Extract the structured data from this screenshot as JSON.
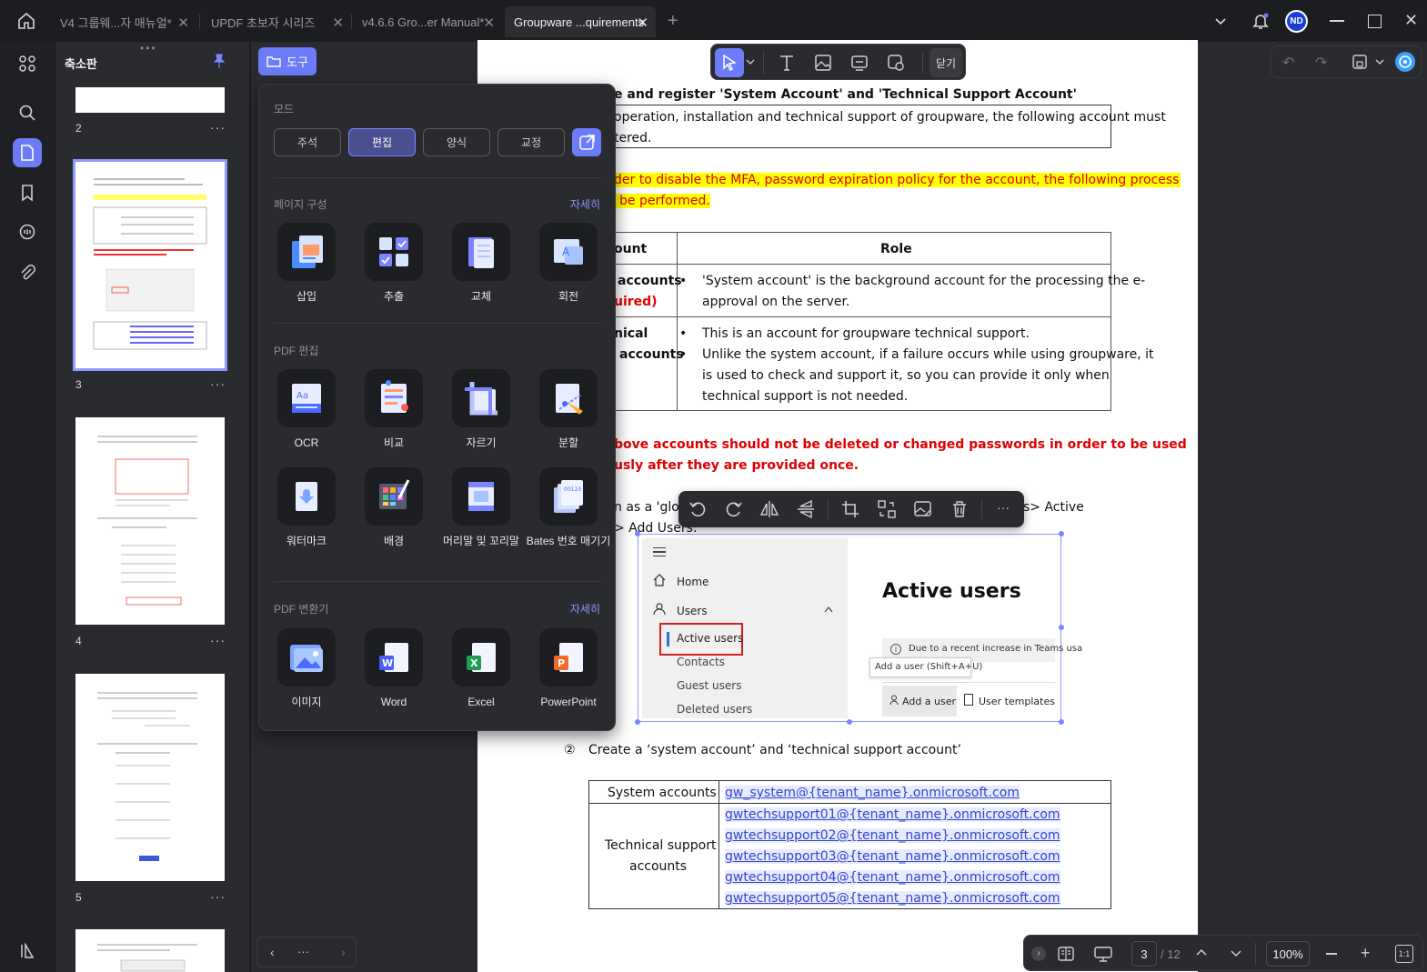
{
  "tabs": [
    {
      "label": "V4 그룹웨...자 매뉴얼*",
      "active": false
    },
    {
      "label": "UPDF 초보자 시리즈",
      "active": false
    },
    {
      "label": "v4.6.6 Gro...er Manual*",
      "active": false
    },
    {
      "label": "Groupware ...quirements",
      "active": true
    }
  ],
  "user_avatar": "ND",
  "thumbnails": {
    "title": "축소판",
    "pages": [
      "2",
      "3",
      "4",
      "5"
    ]
  },
  "tools_button": "도구",
  "tools_panel": {
    "mode_title": "모드",
    "modes": [
      "주석",
      "편집",
      "양식",
      "교정"
    ],
    "active_mode": "편집",
    "page_section": {
      "title": "페이지 구성",
      "more": "자세히",
      "items": [
        "삽입",
        "추출",
        "교체",
        "회전"
      ]
    },
    "pdf_edit_section": {
      "title": "PDF 편집",
      "items": [
        "OCR",
        "비교",
        "자르기",
        "분할",
        "워터마크",
        "배경",
        "머리말 및 꼬리말",
        "Bates 번호 매기기"
      ]
    },
    "convert_section": {
      "title": "PDF 변환기",
      "more": "자세히",
      "items": [
        "이미지",
        "Word",
        "Excel",
        "PowerPoint"
      ]
    }
  },
  "edit_toolbar": {
    "close_label": "닫기"
  },
  "document": {
    "heading": "e and register 'System Account' and 'Technical Support Account'",
    "box_line1": "operation, installation and technical support of groupware, the following account must",
    "box_line2": "tered.",
    "highlight_line1": "der to disable the MFA, password expiration policy for the account, the following process",
    "highlight_line2": "be performed.",
    "table1": {
      "col_account": "ount",
      "col_role": "Role",
      "row1_name1": "accounts",
      "row1_name2": "uired)",
      "row1_bullet": "'System account' is the background account for the processing the e-",
      "row1_bullet_cont": "approval on the server.",
      "row2_name1": "nical",
      "row2_name2": "accounts",
      "row2_b1": "This is an account for groupware technical support.",
      "row2_b2a": "Unlike the system account, if a failure occurs while using groupware, it",
      "row2_b2b": "is used to check and support it, so you can provide it only when",
      "row2_b2c": "technical support is not needed."
    },
    "warn_line1": "bove accounts should not be deleted or changed passwords in order to be used",
    "warn_line2": "usly after they are provided once.",
    "step1_a": "n as a 'glob",
    "step1_b": "s> Active",
    "step1_c": "> Add Users.",
    "screenshot": {
      "nav_home": "Home",
      "nav_users": "Users",
      "nav_active": "Active users",
      "nav_contacts": "Contacts",
      "nav_guest": "Guest users",
      "nav_deleted": "Deleted users",
      "title": "Active users",
      "notice": "Due to a recent increase in Teams usa",
      "tooltip": "Add a user (Shift+A+U)",
      "add_user": "Add a user",
      "templates": "User templates"
    },
    "step2_num": "②",
    "step2": "Create a ‘system account’ and ‘technical support account’",
    "table2": {
      "system_label": "System accounts",
      "system_email": "gw_system@{tenant_name}.onmicrosoft.com",
      "support_label1": "Technical support",
      "support_label2": "accounts",
      "support_emails": [
        "gwtechsupport01@{tenant_name}.onmicrosoft.com",
        "gwtechsupport02@{tenant_name}.onmicrosoft.com",
        "gwtechsupport03@{tenant_name}.onmicrosoft.com",
        "gwtechsupport04@{tenant_name}.onmicrosoft.com",
        "gwtechsupport05@{tenant_name}.onmicrosoft.com"
      ]
    }
  },
  "status": {
    "current_page": "3",
    "total_pages": "/ 12",
    "zoom": "100%",
    "ratio": "1:1"
  },
  "thumb_nav_dots": "···",
  "colors": {
    "accent": "#6c7bf7",
    "highlight": "#ffff00",
    "warn": "#e00000",
    "link": "#3344cc"
  }
}
